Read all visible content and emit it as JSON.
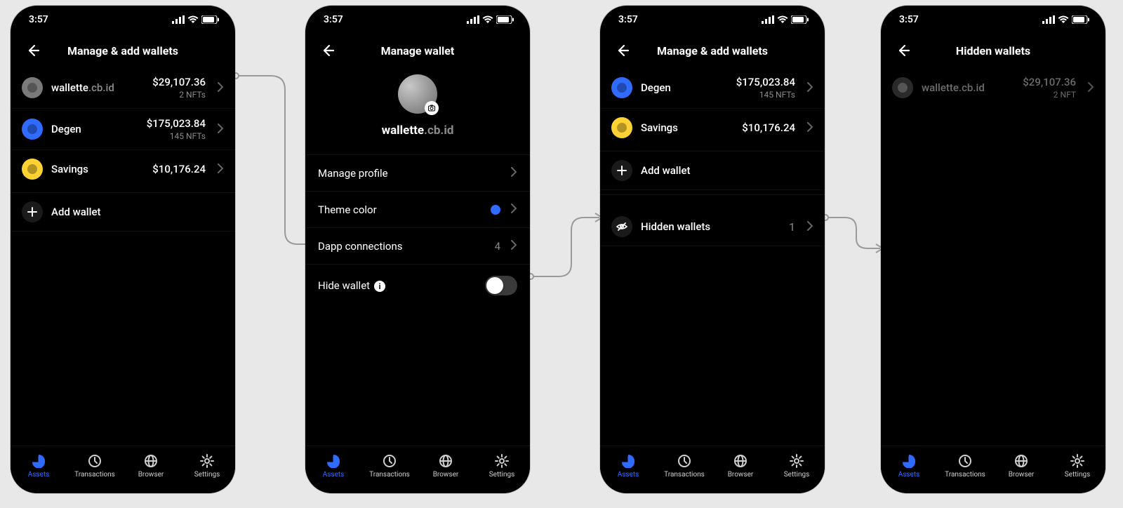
{
  "statusbar": {
    "time": "3:57"
  },
  "tabs": {
    "assets": "Assets",
    "transactions": "Transactions",
    "browser": "Browser",
    "settings": "Settings",
    "active": "assets"
  },
  "screen1": {
    "title": "Manage & add wallets",
    "wallets": [
      {
        "name_main": "wallette",
        "name_dim": ".cb.id",
        "value": "$29,107.36",
        "sub": "2 NFTs",
        "avatar": "grey"
      },
      {
        "name_main": "Degen",
        "name_dim": "",
        "value": "$175,023.84",
        "sub": "145 NFTs",
        "avatar": "blue"
      },
      {
        "name_main": "Savings",
        "name_dim": "",
        "value": "$10,176.24",
        "sub": "",
        "avatar": "yellow"
      }
    ],
    "add_wallet": "Add wallet"
  },
  "screen2": {
    "title": "Manage wallet",
    "profile_name_main": "wallette",
    "profile_name_dim": ".cb.id",
    "rows": {
      "manage_profile": "Manage profile",
      "theme_color": "Theme color",
      "dapp_conn": "Dapp connections",
      "dapp_count": "4",
      "hide_wallet": "Hide wallet"
    },
    "theme_color_hex": "#2f6bff",
    "hide_wallet_on": false
  },
  "screen3": {
    "title": "Manage & add wallets",
    "wallets": [
      {
        "name_main": "Degen",
        "name_dim": "",
        "value": "$175,023.84",
        "sub": "145 NFTs",
        "avatar": "blue"
      },
      {
        "name_main": "Savings",
        "name_dim": "",
        "value": "$10,176.24",
        "sub": "",
        "avatar": "yellow"
      }
    ],
    "add_wallet": "Add wallet",
    "hidden_row": {
      "label": "Hidden wallets",
      "count": "1"
    }
  },
  "screen4": {
    "title": "Hidden wallets",
    "wallets": [
      {
        "name_main": "wallette.cb.id",
        "name_dim": "",
        "value": "$29,107.36",
        "sub": "2 NFT",
        "avatar": "grey",
        "dimmed": true
      }
    ]
  }
}
